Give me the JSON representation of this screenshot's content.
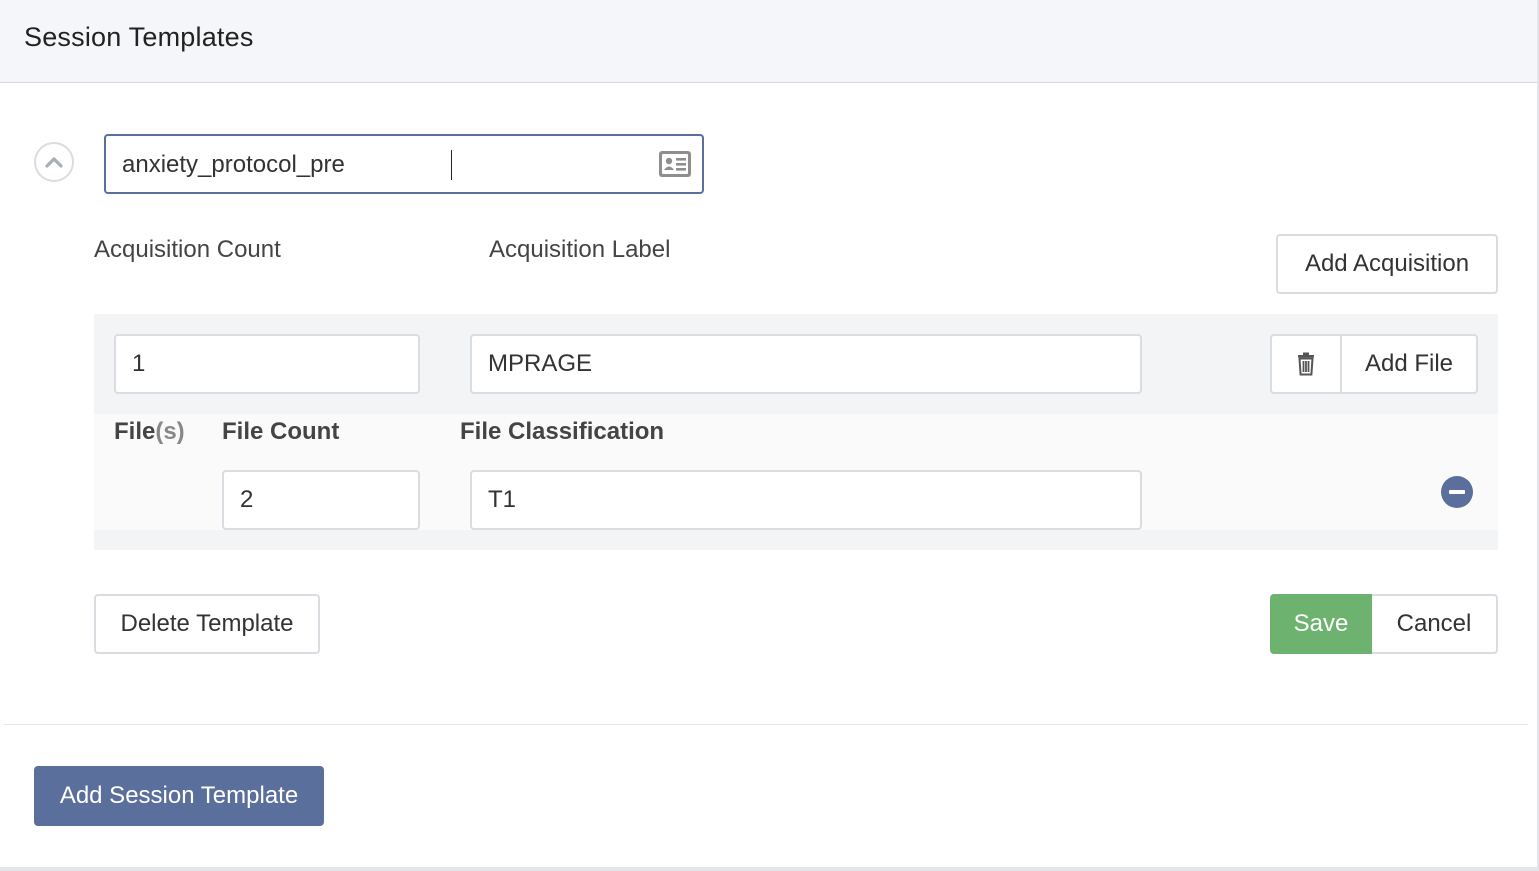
{
  "header": {
    "title": "Session Templates"
  },
  "template": {
    "name_value": "anxiety_protocol_pre",
    "collapse_icon": "chevron-up-icon",
    "name_field_icon": "id-card-icon"
  },
  "acquisition_header": {
    "count_label": "Acquisition Count",
    "label_label": "Acquisition Label",
    "add_acquisition": "Add Acquisition"
  },
  "acquisition": {
    "count_value": "1",
    "label_value": "MPRAGE",
    "delete_icon": "trash-icon",
    "add_file": "Add File"
  },
  "files": {
    "files_label_main": "File",
    "files_label_suffix": "(s)",
    "file_count_label": "File Count",
    "file_classification_label": "File Classification",
    "rows": [
      {
        "count_value": "2",
        "classification_value": "T1",
        "remove_icon": "minus-circle-icon"
      }
    ]
  },
  "actions": {
    "delete_template": "Delete Template",
    "save": "Save",
    "cancel": "Cancel"
  },
  "footer": {
    "add_session_template": "Add Session Template"
  },
  "colors": {
    "primary": "#5a6f9c",
    "success": "#6db36f",
    "header_bg": "#f5f6f9",
    "border": "#d9dce1"
  }
}
